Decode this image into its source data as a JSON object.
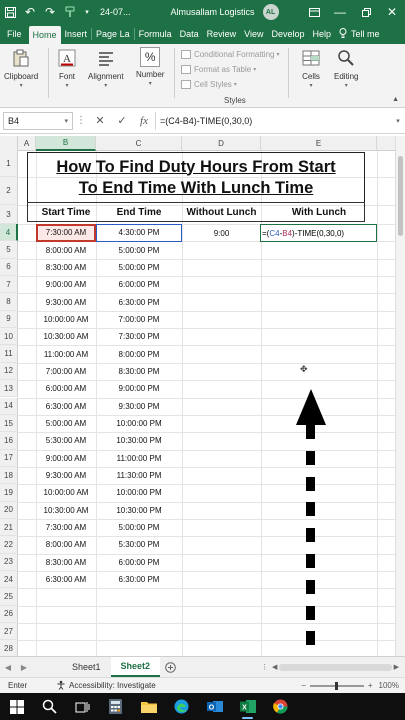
{
  "app": {
    "filename": "24-07...",
    "company": "Almusallam Logistics",
    "avatar_initials": "AL"
  },
  "menu": {
    "tabs": [
      "File",
      "Home",
      "Insert",
      "Page Layout",
      "Formulas",
      "Data",
      "Review",
      "View",
      "Developer",
      "Help"
    ],
    "display": [
      "File",
      "Home",
      "Insert",
      "Page La",
      "Formula",
      "Data",
      "Review",
      "View",
      "Develop",
      "Help"
    ],
    "active": "Home",
    "tell_me": "Tell me"
  },
  "ribbon": {
    "clipboard": "Clipboard",
    "font": "Font",
    "alignment": "Alignment",
    "number": "Number",
    "number_symbol": "%",
    "conditional_formatting": "Conditional Formatting",
    "format_as_table": "Format as Table",
    "cell_styles": "Cell Styles",
    "styles_caption": "Styles",
    "cells": "Cells",
    "editing": "Editing"
  },
  "formula_bar": {
    "name_box": "B4",
    "formula": "=(C4-B4)-TIME(0,30,0)",
    "cancel": "✕",
    "enter": "✓",
    "fx": "fx"
  },
  "grid": {
    "columns": [
      "A",
      "B",
      "C",
      "D",
      "E"
    ],
    "rows": [
      "1",
      "2",
      "3",
      "4",
      "5",
      "6",
      "7",
      "8",
      "9",
      "10",
      "11",
      "12",
      "13",
      "14",
      "15",
      "16",
      "17",
      "18",
      "19",
      "20",
      "21",
      "22",
      "23",
      "24",
      "25",
      "26",
      "27",
      "28"
    ],
    "title_line1": "How To Find Duty Hours From Start",
    "title_line2": "To End Time With Lunch Time",
    "headers": {
      "start": "Start Time",
      "end": "End Time",
      "without": "Without Lunch",
      "with": "With Lunch"
    },
    "start_times": [
      "7:30:00 AM",
      "8:00:00 AM",
      "8:30:00 AM",
      "9:00:00 AM",
      "9:30:00 AM",
      "10:00:00 AM",
      "10:30:00 AM",
      "11:00:00 AM",
      "7:00:00 AM",
      "6:00:00 AM",
      "6:30:00 AM",
      "5:00:00 AM",
      "5:30:00 AM",
      "9:00:00 AM",
      "9:30:00 AM",
      "10:00:00 AM",
      "10:30:00 AM",
      "7:30:00 AM",
      "8:00:00 AM",
      "8:30:00 AM",
      "6:30:00 AM"
    ],
    "end_times": [
      "4:30:00 PM",
      "5:00:00 PM",
      "5:00:00 PM",
      "6:00:00 PM",
      "6:30:00 PM",
      "7:00:00 PM",
      "7:30:00 PM",
      "8:00:00 PM",
      "8:30:00 PM",
      "9:00:00 PM",
      "9:30:00 PM",
      "10:00:00 PM",
      "10:30:00 PM",
      "11:00:00 PM",
      "11:30:00 PM",
      "10:00:00 PM",
      "10:30:00 PM",
      "5:00:00 PM",
      "5:30:00 PM",
      "6:00:00 PM",
      "6:30:00 PM"
    ],
    "d4_value": "9:00",
    "e4_formula": {
      "prefix": "=(",
      "ref_c": "C4",
      "minus": "-",
      "ref_b": "B4",
      "suffix": ")-TIME(0,30,0)"
    }
  },
  "sheets": {
    "tabs": [
      "Sheet1",
      "Sheet2"
    ],
    "active": "Sheet2"
  },
  "status": {
    "mode": "Enter",
    "accessibility": "Accessibility: Investigate",
    "zoom": "100%"
  },
  "colors": {
    "excel_green": "#1e7145",
    "selection_red": "#c0392b",
    "ref_blue": "#2b5cc4",
    "ref_pink": "#b03060"
  }
}
